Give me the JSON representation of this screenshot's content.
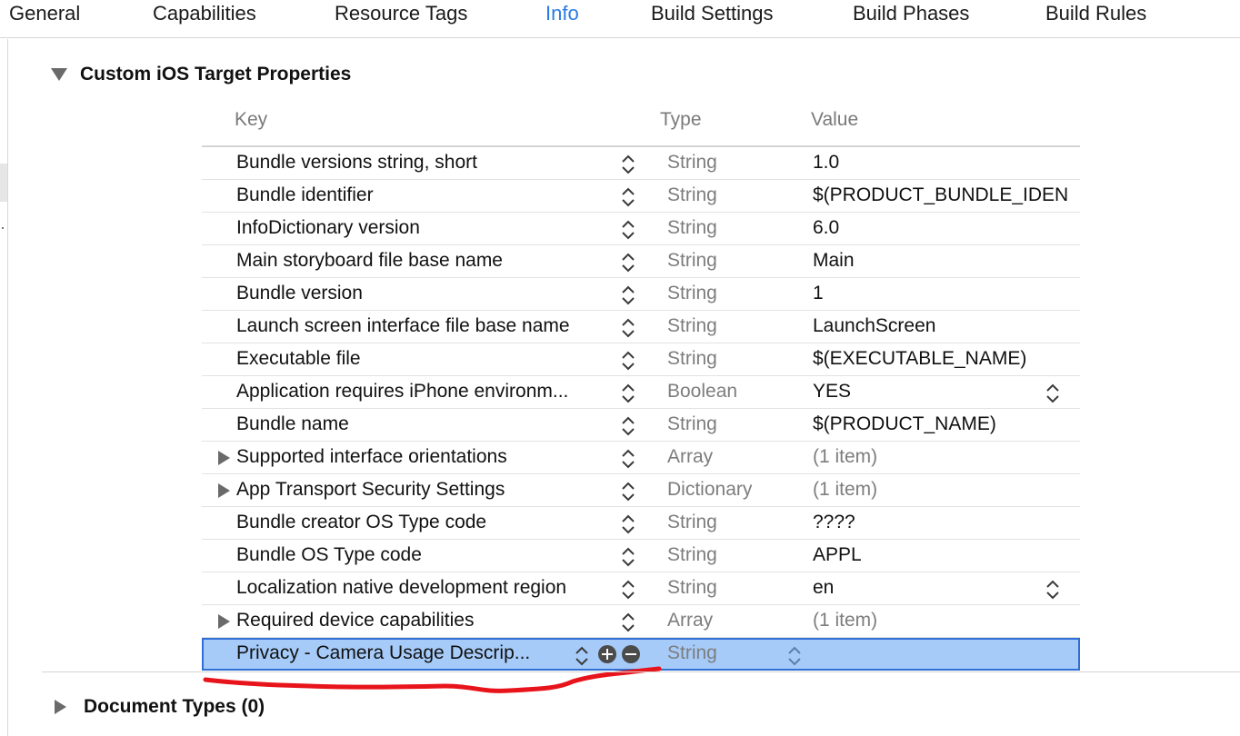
{
  "tabs": [
    {
      "label": "General",
      "active": false
    },
    {
      "label": "Capabilities",
      "active": false
    },
    {
      "label": "Resource Tags",
      "active": false
    },
    {
      "label": "Info",
      "active": true
    },
    {
      "label": "Build Settings",
      "active": false
    },
    {
      "label": "Build Phases",
      "active": false
    },
    {
      "label": "Build Rules",
      "active": false
    }
  ],
  "sections": {
    "custom_properties": {
      "title": "Custom iOS Target Properties",
      "expanded": true
    },
    "document_types": {
      "title": "Document Types (0)",
      "expanded": false
    }
  },
  "table": {
    "headers": {
      "key": "Key",
      "type": "Type",
      "value": "Value"
    },
    "rows": [
      {
        "key": "Bundle versions string, short",
        "type": "String",
        "value": "1.0"
      },
      {
        "key": "Bundle identifier",
        "type": "String",
        "value": "$(PRODUCT_BUNDLE_IDEN"
      },
      {
        "key": "InfoDictionary version",
        "type": "String",
        "value": "6.0"
      },
      {
        "key": "Main storyboard file base name",
        "type": "String",
        "value": "Main"
      },
      {
        "key": "Bundle version",
        "type": "String",
        "value": "1"
      },
      {
        "key": "Launch screen interface file base name",
        "type": "String",
        "value": "LaunchScreen"
      },
      {
        "key": "Executable file",
        "type": "String",
        "value": "$(EXECUTABLE_NAME)"
      },
      {
        "key": "Application requires iPhone environm...",
        "type": "Boolean",
        "value": "YES"
      },
      {
        "key": "Bundle name",
        "type": "String",
        "value": "$(PRODUCT_NAME)"
      },
      {
        "key": "Supported interface orientations",
        "type": "Array",
        "value": "(1 item)"
      },
      {
        "key": "App Transport Security Settings",
        "type": "Dictionary",
        "value": "(1 item)"
      },
      {
        "key": "Bundle creator OS Type code",
        "type": "String",
        "value": "????"
      },
      {
        "key": "Bundle OS Type code",
        "type": "String",
        "value": "APPL"
      },
      {
        "key": "Localization native development region",
        "type": "String",
        "value": "en"
      },
      {
        "key": "Required device capabilities",
        "type": "Array",
        "value": "(1 item)"
      },
      {
        "key": "Privacy - Camera Usage Descrip...",
        "type": "String",
        "value": ""
      }
    ]
  },
  "colors": {
    "accent": "#2a7ae4",
    "selection_fill": "#a6cbf9",
    "selection_border": "#2f6fd6",
    "annotation_red": "#e8141b"
  },
  "icons": [
    "disclosure-triangle-icon",
    "stepper-arrows-icon",
    "plus-circle-icon",
    "minus-circle-icon"
  ]
}
